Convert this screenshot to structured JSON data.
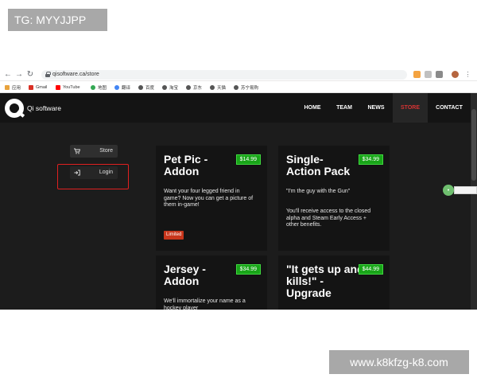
{
  "watermarks": {
    "top": "TG: MYYJJPP",
    "bottom": "www.k8kfzg-k8.com"
  },
  "browser": {
    "nav_icons": [
      "back-icon",
      "forward-icon",
      "reload-icon"
    ],
    "url": "qisoftware.ca/store",
    "bookmarks": [
      {
        "label": "应用",
        "color": "#e8a33d"
      },
      {
        "label": "Gmail",
        "color": "#d93025"
      },
      {
        "label": "YouTube",
        "color": "#ff0000"
      },
      {
        "label": "地图",
        "color": "#34a853"
      },
      {
        "label": "翻译",
        "color": "#4285f4"
      },
      {
        "label": "百度",
        "color": "#555555"
      },
      {
        "label": "淘宝",
        "color": "#555555"
      },
      {
        "label": "京东",
        "color": "#555555"
      },
      {
        "label": "天猫",
        "color": "#555555"
      },
      {
        "label": "苏宁易购",
        "color": "#555555"
      }
    ]
  },
  "site": {
    "logo_text": "Qi software",
    "nav": [
      {
        "label": "HOME",
        "active": false
      },
      {
        "label": "TEAM",
        "active": false
      },
      {
        "label": "NEWS",
        "active": false
      },
      {
        "label": "STORE",
        "active": true
      },
      {
        "label": "CONTACT",
        "active": false
      }
    ],
    "side_menu": [
      {
        "label": "Store",
        "icon": "cart-icon"
      },
      {
        "label": "Login",
        "icon": "sign-in-icon"
      }
    ],
    "products": [
      {
        "title": "Pet Pic - Addon",
        "price": "$14.99",
        "desc": "Want your four legged friend in game? Now you can get a picture of them in-game!",
        "badge": "Limited"
      },
      {
        "title": "Single-Action Pack",
        "price": "$34.99",
        "desc": "\"I'm the guy with the Gun\"",
        "desc2": "You'll receive access to the closed alpha and Steam Early Access + other benefits."
      },
      {
        "title": "Jersey - Addon",
        "price": "$34.99",
        "desc": "We'll immortalize your name as a hockey player"
      },
      {
        "title": "\"It gets up and kills!\" - Upgrade",
        "price": "$44.99",
        "desc": ""
      }
    ]
  },
  "colors": {
    "accent": "#d63333",
    "price_green": "#19a519",
    "badge_red": "#c8361c",
    "site_bg": "#1c1c1c"
  }
}
